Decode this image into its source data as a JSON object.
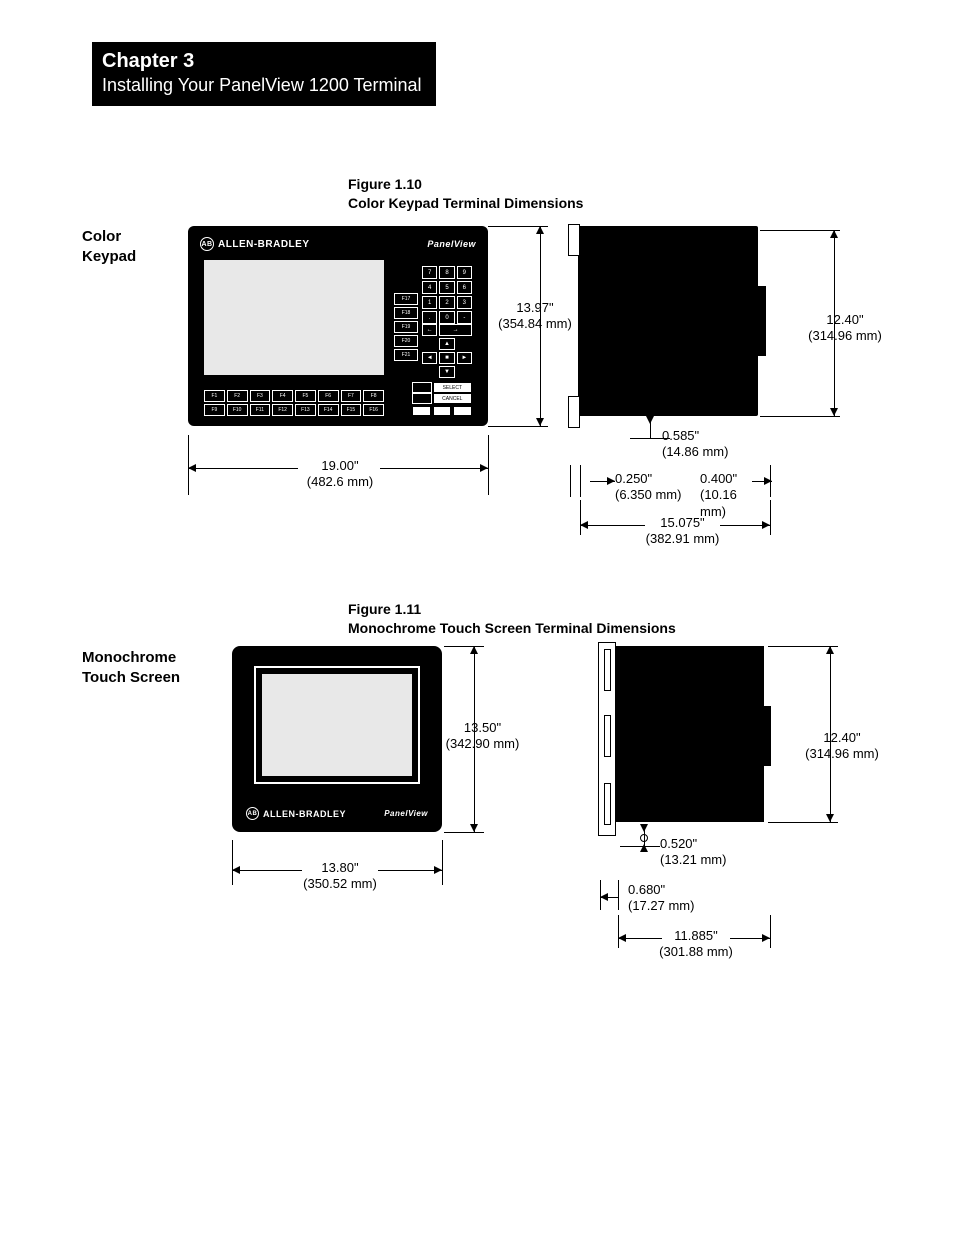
{
  "header": {
    "chapter": "Chapter 3",
    "subtitle": "Installing Your PanelView 1200 Terminal"
  },
  "fig110": {
    "number": "Figure 1.10",
    "title": "Color Keypad Terminal Dimensions",
    "side_label_l1": "Color",
    "side_label_l2": "Keypad",
    "brand": "ALLEN-BRADLEY",
    "product": "PanelView",
    "fkeys_row1": [
      "F1",
      "F2",
      "F3",
      "F4",
      "F5",
      "F6",
      "F7",
      "F8"
    ],
    "fkeys_row2": [
      "F9",
      "F10",
      "F11",
      "F12",
      "F13",
      "F14",
      "F15",
      "F16"
    ],
    "sidefn": [
      "F17",
      "F18",
      "F19",
      "F20",
      "F21"
    ],
    "numpad": [
      "7",
      "8",
      "9",
      "4",
      "5",
      "6",
      "1",
      "2",
      "3",
      ".",
      "0",
      "-"
    ],
    "arrow_left": "←",
    "arrow_right": "→",
    "arrow_up": "▲",
    "arrow_down": "▼",
    "arrow_tri_left": "◄",
    "arrow_tri_center": "■",
    "arrow_tri_right": "►",
    "select": "SELECT",
    "cancel": "CANCEL",
    "dim_front_h_in": "13.97\"",
    "dim_front_h_mm": "(354.84 mm)",
    "dim_front_w_in": "19.00\"",
    "dim_front_w_mm": "(482.6 mm)",
    "dim_side_h_in": "12.40\"",
    "dim_side_h_mm": "(314.96 mm)",
    "dim_585_in": "0.585\"",
    "dim_585_mm": "(14.86 mm)",
    "dim_250_in": "0.250\"",
    "dim_250_mm": "(6.350 mm)",
    "dim_400_in": "0.400\"",
    "dim_400_mm": "(10.16 mm)",
    "dim_depth_in": "15.075\"",
    "dim_depth_mm": "(382.91 mm)"
  },
  "fig111": {
    "number": "Figure 1.11",
    "title": "Monochrome Touch Screen Terminal Dimensions",
    "side_label_l1": "Monochrome",
    "side_label_l2": "Touch Screen",
    "brand": "ALLEN-BRADLEY",
    "product": "PanelView",
    "dim_front_h_in": "13.50\"",
    "dim_front_h_mm": "(342.90 mm)",
    "dim_front_w_in": "13.80\"",
    "dim_front_w_mm": "(350.52 mm)",
    "dim_side_h_in": "12.40\"",
    "dim_side_h_mm": "(314.96 mm)",
    "dim_520_in": "0.520\"",
    "dim_520_mm": "(13.21 mm)",
    "dim_680_in": "0.680\"",
    "dim_680_mm": "(17.27 mm)",
    "dim_depth_in": "11.885\"",
    "dim_depth_mm": "(301.88 mm)"
  }
}
